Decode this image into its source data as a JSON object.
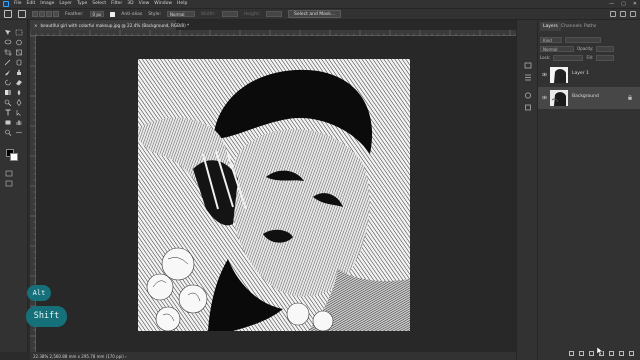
{
  "menubar": {
    "items": [
      "File",
      "Edit",
      "Image",
      "Layer",
      "Type",
      "Select",
      "Filter",
      "3D",
      "View",
      "Window",
      "Help"
    ],
    "window_controls": [
      "—",
      "▢",
      "✕"
    ]
  },
  "options": {
    "feather_label": "Feather:",
    "feather_value": "0 px",
    "antialias_label": "Anti-alias",
    "style_label": "Style:",
    "style_value": "Normal",
    "width_label": "Width:",
    "height_label": "Height:",
    "select_mask_button": "Select and Mask..."
  },
  "document": {
    "tab_title": "beautiful girl with colorful makeup.jpg @ 22.4% (Background, RGB/8) *",
    "tab_close": "×",
    "status": "22.38%   2,560.88 mm x 295.78 mm (170 ppi)   ›"
  },
  "layers_panel": {
    "tabs": [
      "Layers",
      "Channels",
      "Paths"
    ],
    "kind_label": "Kind",
    "mode_label": "Normal",
    "opacity_label": "Opacity:",
    "lock_label": "Lock:",
    "fill_label": "Fill:",
    "layers": [
      {
        "name": "Layer 1",
        "selected": false
      },
      {
        "name": "Background",
        "selected": true
      }
    ]
  },
  "key_overlay": {
    "keys": [
      "Alt",
      "Shift"
    ],
    "color": "#15707a"
  },
  "colors": {
    "foreground": "#000000",
    "background": "#ffffff",
    "accent": "#31a8ff"
  }
}
